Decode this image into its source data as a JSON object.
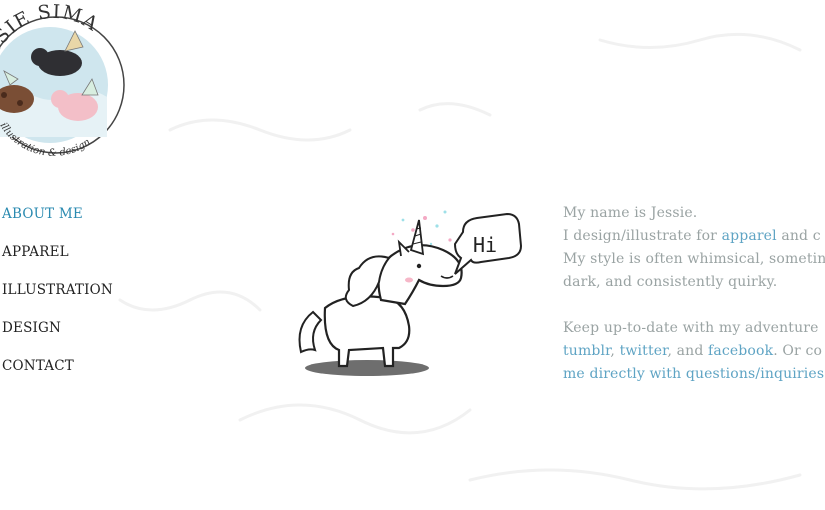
{
  "logo": {
    "name": "JESSIE SIMA",
    "tagline": "illustration & design"
  },
  "nav": {
    "items": [
      {
        "label": "ABOUT ME",
        "active": true
      },
      {
        "label": "APPAREL",
        "active": false
      },
      {
        "label": "ILLUSTRATION",
        "active": false
      },
      {
        "label": "DESIGN",
        "active": false
      },
      {
        "label": "CONTACT",
        "active": false
      }
    ]
  },
  "illustration": {
    "speech_bubble": "Hi"
  },
  "intro": {
    "p1": {
      "line1": "My name is Jessie.",
      "line2_pre": "I design/illustrate for ",
      "line2_link": "apparel",
      "line2_post": " and c",
      "line3": "My style is often whimsical, sometin",
      "line4": "dark, and consistently quirky."
    },
    "p2": {
      "line1": "Keep up-to-date with my adventure",
      "link_tumblr": "tumblr",
      "comma": ", ",
      "link_twitter": "twitter",
      "and": ", and ",
      "link_facebook": "facebook",
      "line2_post": ". Or co",
      "line3": "me directly with questions/inquiries"
    }
  },
  "colors": {
    "accent": "#2a8ab0",
    "text_muted": "#9aa3a3",
    "link": "#5fa4c4"
  }
}
